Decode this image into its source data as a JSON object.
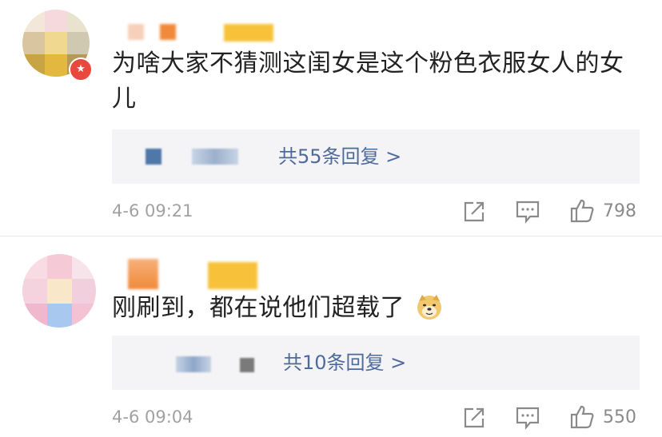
{
  "comments": [
    {
      "text": "为啥大家不猜测这闺女是这个粉色衣服女人的女儿",
      "replies_label": "共55条回复 >",
      "time": "4-6 09:21",
      "likes": "798",
      "badge_icon": "vip-badge-icon"
    },
    {
      "text": "刚刷到，都在说他们超载了",
      "emoji": "doge-emoji-icon",
      "replies_label": "共10条回复 >",
      "time": "4-6 09:04",
      "likes": "550"
    }
  ],
  "colors": {
    "link": "#4e6a9a",
    "meta": "#a1a1a1",
    "reply_bg": "#f4f4f6",
    "badge": "#e8483d"
  }
}
